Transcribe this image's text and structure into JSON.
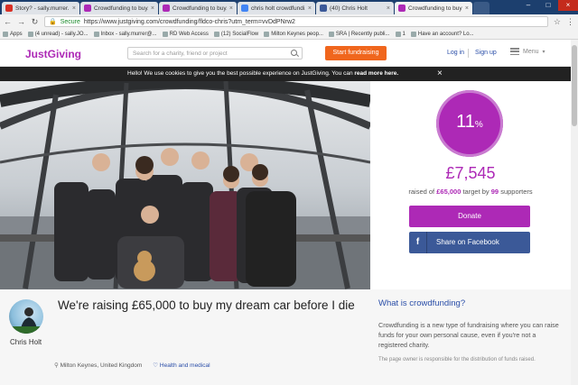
{
  "browser": {
    "tabs": [
      {
        "title": "Story? - sally.murrer...",
        "favicon_color": "#d93025"
      },
      {
        "title": "Crowdfunding to buy...",
        "favicon_color": "#ad29b6"
      },
      {
        "title": "Crowdfunding to buy...",
        "favicon_color": "#ad29b6"
      },
      {
        "title": "chris holt crowdfundi...",
        "favicon_color": "#4285f4"
      },
      {
        "title": "(40) Chris Holt",
        "favicon_color": "#3b5998"
      },
      {
        "title": "Crowdfunding to buy",
        "favicon_color": "#ad29b6"
      }
    ],
    "active_tab": 5,
    "address": {
      "secure_label": "Secure",
      "url": "https://www.justgiving.com/crowdfunding/fldco-chris?utm_term=vvDdPNrw2"
    },
    "bookmarks": [
      "Apps",
      "(4 unread) - sally.JO...",
      "Inbox - sally.murrer@...",
      "RD Web Access",
      "(12) SocialFlow",
      "Milton Keynes peop...",
      "SRA | Recently publi...",
      "1",
      "Have an account? Lo..."
    ]
  },
  "site": {
    "logo": "JustGiving",
    "search_placeholder": "Search for a charity, friend or project",
    "start_button": "Start fundraising",
    "login": "Log in",
    "signup": "Sign up",
    "menu": "Menu",
    "cookie_text": "Hello! We use cookies to give you the best possible experience on JustGiving. You can",
    "cookie_link": "read more here."
  },
  "campaign": {
    "percent": "11",
    "percent_sign": "%",
    "raised": "£7,545",
    "raised_of": "raised of",
    "target": "£65,000",
    "target_by": "target by",
    "supporters_count": "99",
    "supporters_label": "supporters",
    "donate": "Donate",
    "share": "Share on Facebook",
    "title": "We're raising £65,000 to buy my dream car before I die",
    "owner": "Chris Holt",
    "location": "Milton Keynes, United Kingdom",
    "category": "Health and medical"
  },
  "info": {
    "heading": "What is crowdfunding?",
    "body": "Crowdfunding is a new type of fundraising where you can raise funds for your own personal cause, even if you're not a registered charity.",
    "note": "The page owner is responsible for the distribution of funds raised."
  },
  "colors": {
    "brand": "#ad29b6",
    "orange": "#f0661d",
    "facebook": "#3b5998"
  }
}
